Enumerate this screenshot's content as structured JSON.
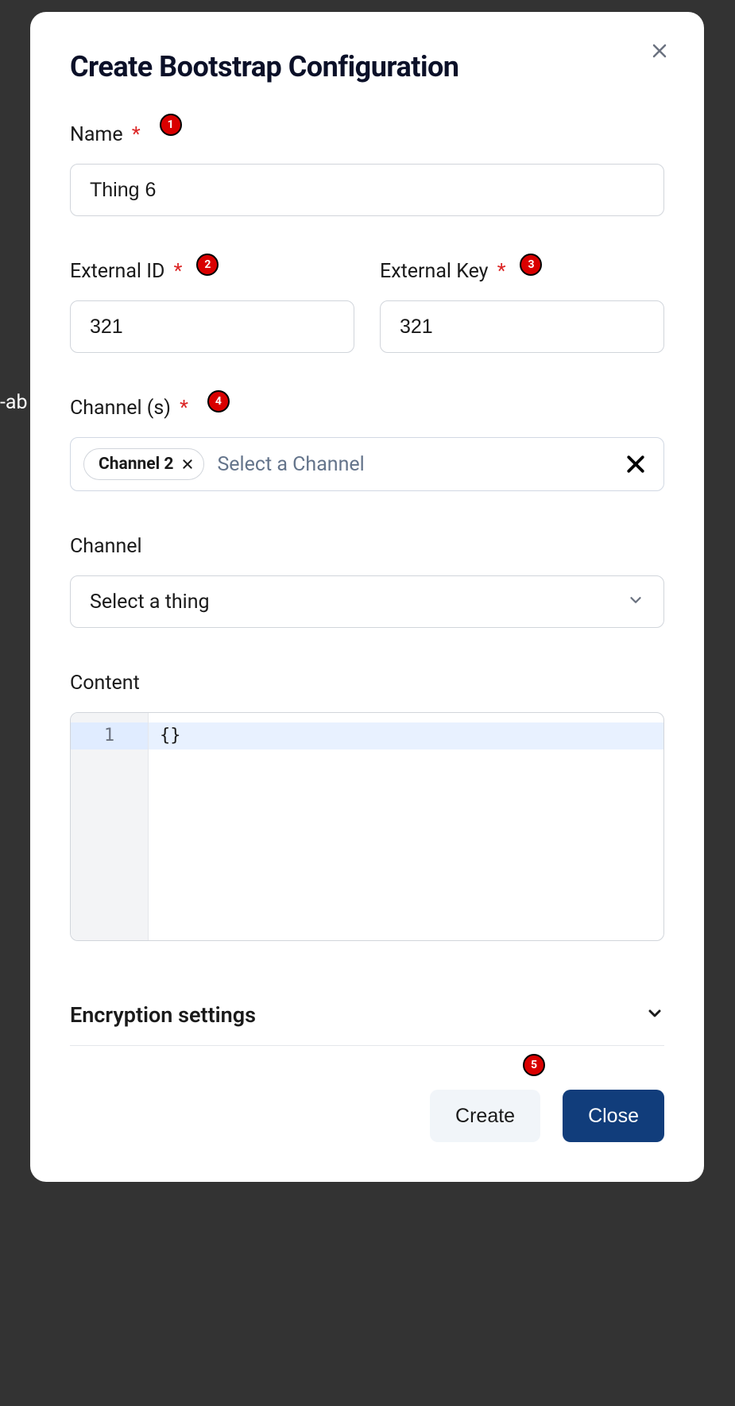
{
  "background_text": "-ab",
  "modal": {
    "title": "Create Bootstrap Configuration",
    "fields": {
      "name": {
        "label": "Name",
        "required": "*",
        "value": "Thing 6",
        "badge": "1"
      },
      "external_id": {
        "label": "External ID",
        "required": "*",
        "value": "321",
        "badge": "2"
      },
      "external_key": {
        "label": "External Key",
        "required": "*",
        "value": "321",
        "badge": "3"
      },
      "channels": {
        "label": "Channel (s)",
        "required": "*",
        "badge": "4",
        "chip": "Channel 2",
        "placeholder": "Select a Channel"
      },
      "channel": {
        "label": "Channel",
        "placeholder": "Select a thing"
      },
      "content": {
        "label": "Content",
        "line_num": "1",
        "code": "{}"
      },
      "encryption": {
        "label": "Encryption settings"
      }
    },
    "footer": {
      "badge": "5",
      "create": "Create",
      "close": "Close"
    }
  }
}
